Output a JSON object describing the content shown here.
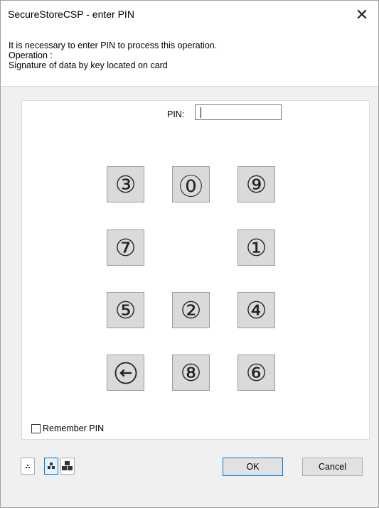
{
  "window": {
    "title": "SecureStoreCSP - enter PIN",
    "close_glyph": "✕"
  },
  "info": {
    "line1": "It is necessary to enter PIN to process this operation.",
    "line2": "Operation :",
    "line3": "Signature of data by key located on card"
  },
  "pin": {
    "label": "PIN:",
    "value": ""
  },
  "keypad": {
    "keys": [
      {
        "glyph": "③",
        "digit": "3"
      },
      {
        "glyph": "⓪",
        "digit": "0"
      },
      {
        "glyph": "⑨",
        "digit": "9"
      },
      {
        "glyph": "⑦",
        "digit": "7"
      },
      {
        "glyph": "①",
        "digit": "1"
      },
      {
        "glyph": "⑤",
        "digit": "5"
      },
      {
        "glyph": "②",
        "digit": "2"
      },
      {
        "glyph": "④",
        "digit": "4"
      },
      {
        "glyph": "⊖",
        "digit": "backspace"
      },
      {
        "glyph": "⑧",
        "digit": "8"
      },
      {
        "glyph": "⑥",
        "digit": "6"
      }
    ]
  },
  "remember": {
    "label": "Remember PIN",
    "checked": false
  },
  "size_buttons": {
    "selected": "medium"
  },
  "buttons": {
    "ok": "OK",
    "cancel": "Cancel"
  },
  "colors": {
    "focus_blue": "#0078d7",
    "key_face": "#dadada",
    "dialog_bg": "#f0f0f0"
  }
}
